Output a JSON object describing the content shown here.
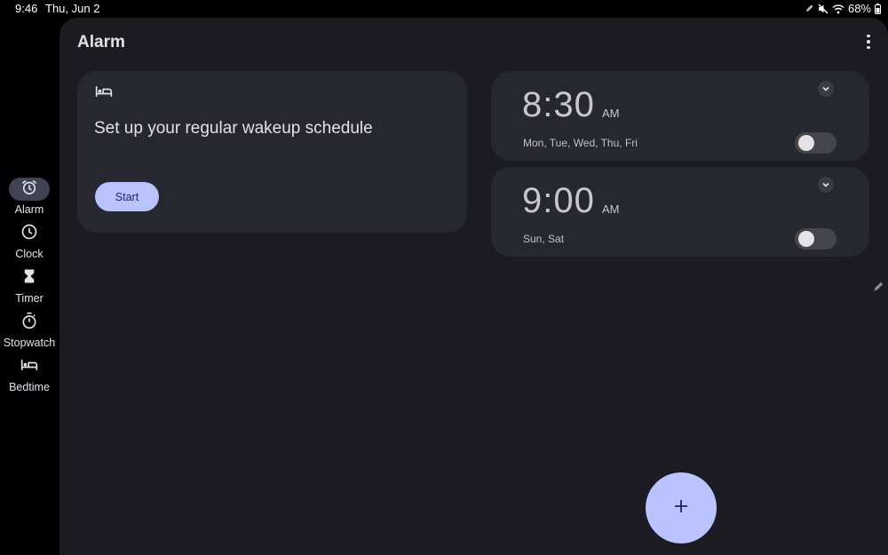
{
  "status_bar": {
    "time": "9:46",
    "date": "Thu, Jun 2",
    "battery": "68%",
    "icons": [
      "pen-icon",
      "mute-icon",
      "wifi-icon",
      "battery-icon"
    ]
  },
  "nav": {
    "items": [
      {
        "label": "Alarm",
        "icon": "alarm-icon",
        "active": true
      },
      {
        "label": "Clock",
        "icon": "clock-icon",
        "active": false
      },
      {
        "label": "Timer",
        "icon": "hourglass-icon",
        "active": false
      },
      {
        "label": "Stopwatch",
        "icon": "stopwatch-icon",
        "active": false
      },
      {
        "label": "Bedtime",
        "icon": "bed-icon",
        "active": false
      }
    ]
  },
  "header": {
    "title": "Alarm",
    "menu_icon": "more-vert-icon"
  },
  "setup_card": {
    "icon": "bed-icon",
    "text": "Set up your regular wakeup schedule",
    "button_label": "Start"
  },
  "alarms": [
    {
      "time": "8:30",
      "ampm": "AM",
      "days": "Mon, Tue, Wed, Thu, Fri",
      "enabled": false
    },
    {
      "time": "9:00",
      "ampm": "AM",
      "days": "Sun, Sat",
      "enabled": false
    }
  ],
  "fab": {
    "icon": "add-icon"
  },
  "colors": {
    "surface": "#1c1b21",
    "card": "#27272f",
    "accent": "#b9c3ff",
    "on_accent": "#1d2558"
  }
}
